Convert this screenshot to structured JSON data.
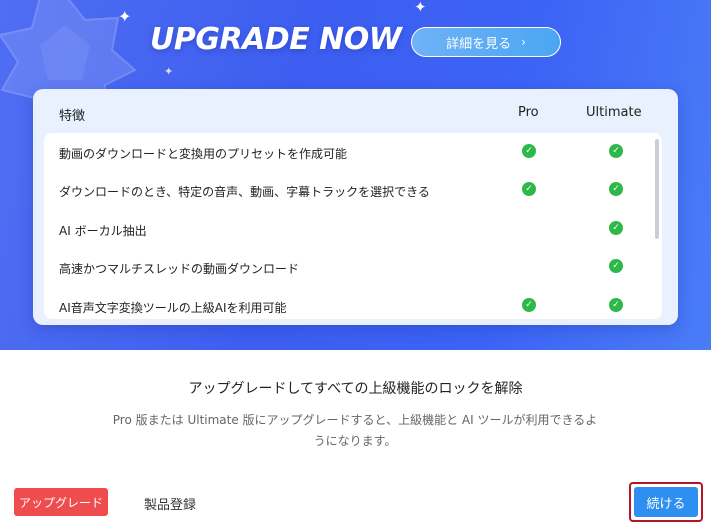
{
  "hero": {
    "title": "UPGRADE NOW",
    "details_button": "詳細を見る",
    "details_chevron": "›"
  },
  "table": {
    "headers": {
      "feature": "特徴",
      "pro": "Pro",
      "ultimate": "Ultimate"
    },
    "rows": [
      {
        "feature": "動画のダウンロードと変換用のプリセットを作成可能",
        "pro": true,
        "ultimate": true
      },
      {
        "feature": "ダウンロードのとき、特定の音声、動画、字幕トラックを選択できる",
        "pro": true,
        "ultimate": true
      },
      {
        "feature": "AI ボーカル抽出",
        "pro": false,
        "ultimate": true
      },
      {
        "feature": "高速かつマルチスレッドの動画ダウンロード",
        "pro": false,
        "ultimate": true
      },
      {
        "feature": "AI音声文字変換ツールの上級AIを利用可能",
        "pro": true,
        "ultimate": true
      }
    ]
  },
  "prompt": {
    "title": "アップグレードしてすべての上級機能のロックを解除",
    "description": "Pro 版または Ultimate 版にアップグレードすると、上級機能と AI ツールが利用できるようになります。"
  },
  "footer": {
    "upgrade_button": "アップグレード",
    "register_link": "製品登録",
    "continue_button": "続ける"
  },
  "colors": {
    "hero_bg": "#3d5ef0",
    "check": "#2fb84a",
    "upgrade": "#ef4d4d",
    "continue": "#2f8ff0",
    "focus_ring": "#b4152a"
  },
  "icons": [
    "sparkle-icon",
    "badge-icon",
    "chevron-right-icon",
    "check-icon"
  ]
}
